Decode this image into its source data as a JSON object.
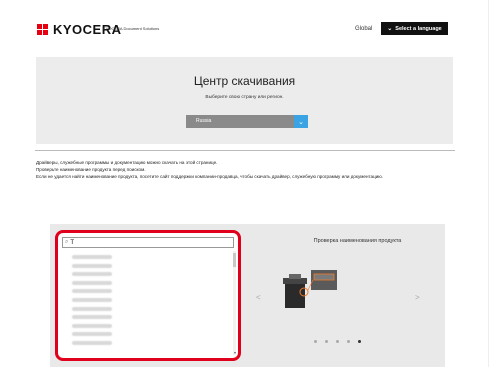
{
  "header": {
    "logo_text": "KYOCERA",
    "sub_brand": "KYOCERA Document Solutions",
    "global_label": "Global",
    "language_button_label": "Select a language",
    "colors": {
      "brand_red": "#e60012",
      "button_bg": "#111111"
    }
  },
  "hero": {
    "title": "Центр скачивания",
    "subtitle": "Выберите свою страну или регион.",
    "region_select": {
      "value": "Russia",
      "arrow_color": "#3aa3e3"
    }
  },
  "info": {
    "lines": [
      "Драйверы, служебные программы и документацию можно скачать на этой странице.",
      "Проверьте наименование продукта перед поиском.",
      "Если не удается найти наименование продукта, посетите сайт поддержки компании-продавца, чтобы скачать драйвер, служебную программу или документацию."
    ]
  },
  "search": {
    "value": "T",
    "results_count_visible": 11,
    "highlight_color": "#e0001b"
  },
  "product_check": {
    "title": "Проверка наименования продукта",
    "slides_total": 5,
    "active_slide": 5
  }
}
